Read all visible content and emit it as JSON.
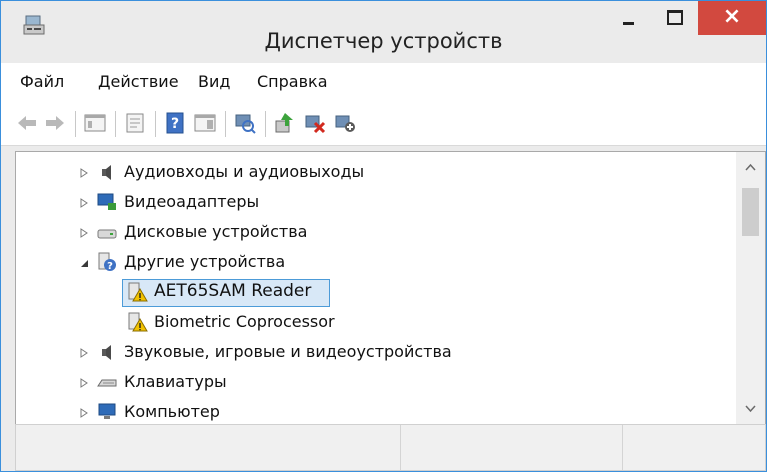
{
  "window": {
    "title": "Диспетчер устройств",
    "close_glyph": "×",
    "accent": "#d2493f"
  },
  "menu": {
    "items": [
      "Файл",
      "Действие",
      "Вид",
      "Справка"
    ]
  },
  "toolbar": {
    "icons": [
      "back-arrow-icon",
      "forward-arrow-icon",
      "show-hide-console-tree-icon",
      "properties-icon",
      "help-icon",
      "action-pane-icon",
      "scan-hardware-changes-icon",
      "update-driver-icon",
      "disable-device-icon",
      "uninstall-device-icon"
    ]
  },
  "tree": {
    "items": [
      {
        "label": "Аудиовходы и аудиовыходы",
        "icon": "speaker-icon",
        "expanded": false
      },
      {
        "label": "Видеоадаптеры",
        "icon": "display-adapter-icon",
        "expanded": false
      },
      {
        "label": "Дисковые устройства",
        "icon": "disk-drive-icon",
        "expanded": false
      },
      {
        "label": "Другие устройства",
        "icon": "unknown-device-icon",
        "expanded": true
      },
      {
        "label": "AET65SAM Reader",
        "icon": "warning-device-icon",
        "selected": true
      },
      {
        "label": "Biometric Coprocessor",
        "icon": "warning-device-icon"
      },
      {
        "label": "Звуковые, игровые и видеоустройства",
        "icon": "sound-icon",
        "expanded": false
      },
      {
        "label": "Клавиатуры",
        "icon": "keyboard-icon",
        "expanded": false
      },
      {
        "label": "Компьютер",
        "icon": "computer-icon",
        "expanded": false
      }
    ]
  }
}
